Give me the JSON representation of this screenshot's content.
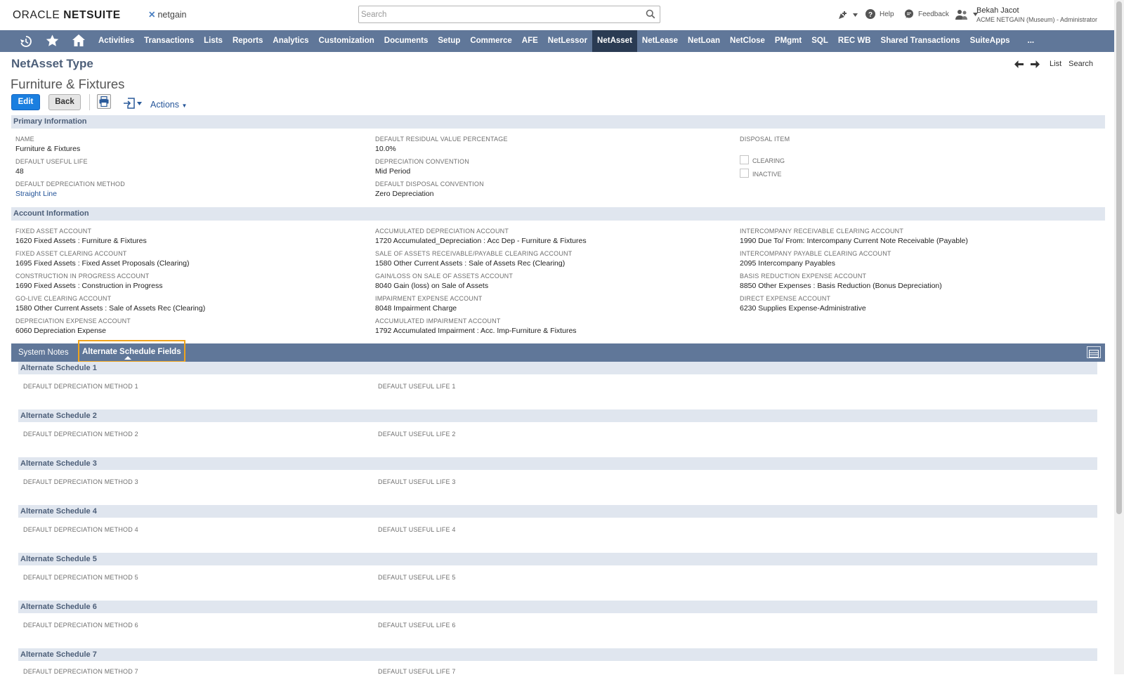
{
  "header": {
    "brand_prefix": "ORACLE",
    "brand_suffix": "NETSUITE",
    "company_logo": "netgain",
    "search_placeholder": "Search",
    "help_label": "Help",
    "feedback_label": "Feedback",
    "user_name": "Bekah Jacot",
    "user_role": "ACME NETGAIN (Museum) - Administrator"
  },
  "nav": {
    "items": [
      "Activities",
      "Transactions",
      "Lists",
      "Reports",
      "Analytics",
      "Customization",
      "Documents",
      "Setup",
      "Commerce",
      "AFE",
      "NetLessor",
      "NetAsset",
      "NetLease",
      "NetLoan",
      "NetClose",
      "PMgmt",
      "SQL",
      "REC WB",
      "Shared Transactions",
      "SuiteApps"
    ],
    "active": "NetAsset",
    "more": "..."
  },
  "page": {
    "record_type": "NetAsset Type",
    "record_name": "Furniture & Fixtures",
    "list_link": "List",
    "search_link": "Search"
  },
  "toolbar": {
    "edit": "Edit",
    "back": "Back",
    "actions": "Actions"
  },
  "primary": {
    "title": "Primary Information",
    "name_label": "NAME",
    "name_value": "Furniture & Fixtures",
    "useful_life_label": "DEFAULT USEFUL LIFE",
    "useful_life_value": "48",
    "dep_method_label": "DEFAULT DEPRECIATION METHOD",
    "dep_method_value": "Straight Line",
    "residual_label": "DEFAULT RESIDUAL VALUE PERCENTAGE",
    "residual_value": "10.0%",
    "dep_conv_label": "DEPRECIATION CONVENTION",
    "dep_conv_value": "Mid Period",
    "disp_conv_label": "DEFAULT DISPOSAL CONVENTION",
    "disp_conv_value": "Zero Depreciation",
    "disposal_item_label": "DISPOSAL ITEM",
    "clearing_label": "CLEARING",
    "inactive_label": "INACTIVE"
  },
  "account": {
    "title": "Account Information",
    "fields": [
      {
        "label": "FIXED ASSET ACCOUNT",
        "value": "1620 Fixed Assets : Furniture & Fixtures"
      },
      {
        "label": "FIXED ASSET CLEARING ACCOUNT",
        "value": "1695 Fixed Assets : Fixed Asset Proposals (Clearing)"
      },
      {
        "label": "CONSTRUCTION IN PROGRESS ACCOUNT",
        "value": "1690 Fixed Assets : Construction in Progress"
      },
      {
        "label": "GO-LIVE CLEARING ACCOUNT",
        "value": "1580 Other Current Assets : Sale of Assets Rec (Clearing)"
      },
      {
        "label": "DEPRECIATION EXPENSE ACCOUNT",
        "value": "6060 Depreciation Expense"
      },
      {
        "label": "ACCUMULATED DEPRECIATION ACCOUNT",
        "value": "1720 Accumulated_Depreciation : Acc Dep - Furniture & Fixtures"
      },
      {
        "label": "SALE OF ASSETS RECEIVABLE/PAYABLE CLEARING ACCOUNT",
        "value": "1580 Other Current Assets : Sale of Assets Rec (Clearing)"
      },
      {
        "label": "GAIN/LOSS ON SALE OF ASSETS ACCOUNT",
        "value": "8040 Gain (loss) on Sale of Assets"
      },
      {
        "label": "IMPAIRMENT EXPENSE ACCOUNT",
        "value": "8048 Impairment Charge"
      },
      {
        "label": "ACCUMULATED IMPAIRMENT ACCOUNT",
        "value": "1792 Accumulated Impairment : Acc. Imp-Furniture & Fixtures"
      },
      {
        "label": "INTERCOMPANY RECEIVABLE CLEARING ACCOUNT",
        "value": "1990 Due To/ From: Intercompany Current Note Receivable (Payable)"
      },
      {
        "label": "INTERCOMPANY PAYABLE CLEARING ACCOUNT",
        "value": "2095 Intercompany Payables"
      },
      {
        "label": "BASIS REDUCTION EXPENSE ACCOUNT",
        "value": "8850 Other Expenses : Basis Reduction (Bonus Depreciation)"
      },
      {
        "label": "DIRECT EXPENSE ACCOUNT",
        "value": "6230 Supplies Expense-Administrative"
      }
    ]
  },
  "tabs": {
    "system_notes": "System Notes",
    "alt_schedule": "Alternate Schedule Fields"
  },
  "schedules": [
    {
      "title": "Alternate Schedule 1",
      "method": "DEFAULT DEPRECIATION METHOD 1",
      "life": "DEFAULT USEFUL LIFE 1"
    },
    {
      "title": "Alternate Schedule 2",
      "method": "DEFAULT DEPRECIATION METHOD 2",
      "life": "DEFAULT USEFUL LIFE 2"
    },
    {
      "title": "Alternate Schedule 3",
      "method": "DEFAULT DEPRECIATION METHOD 3",
      "life": "DEFAULT USEFUL LIFE 3"
    },
    {
      "title": "Alternate Schedule 4",
      "method": "DEFAULT DEPRECIATION METHOD 4",
      "life": "DEFAULT USEFUL LIFE 4"
    },
    {
      "title": "Alternate Schedule 5",
      "method": "DEFAULT DEPRECIATION METHOD 5",
      "life": "DEFAULT USEFUL LIFE 5"
    },
    {
      "title": "Alternate Schedule 6",
      "method": "DEFAULT DEPRECIATION METHOD 6",
      "life": "DEFAULT USEFUL LIFE 6"
    },
    {
      "title": "Alternate Schedule 7",
      "method": "DEFAULT DEPRECIATION METHOD 7",
      "life": "DEFAULT USEFUL LIFE 7"
    }
  ]
}
